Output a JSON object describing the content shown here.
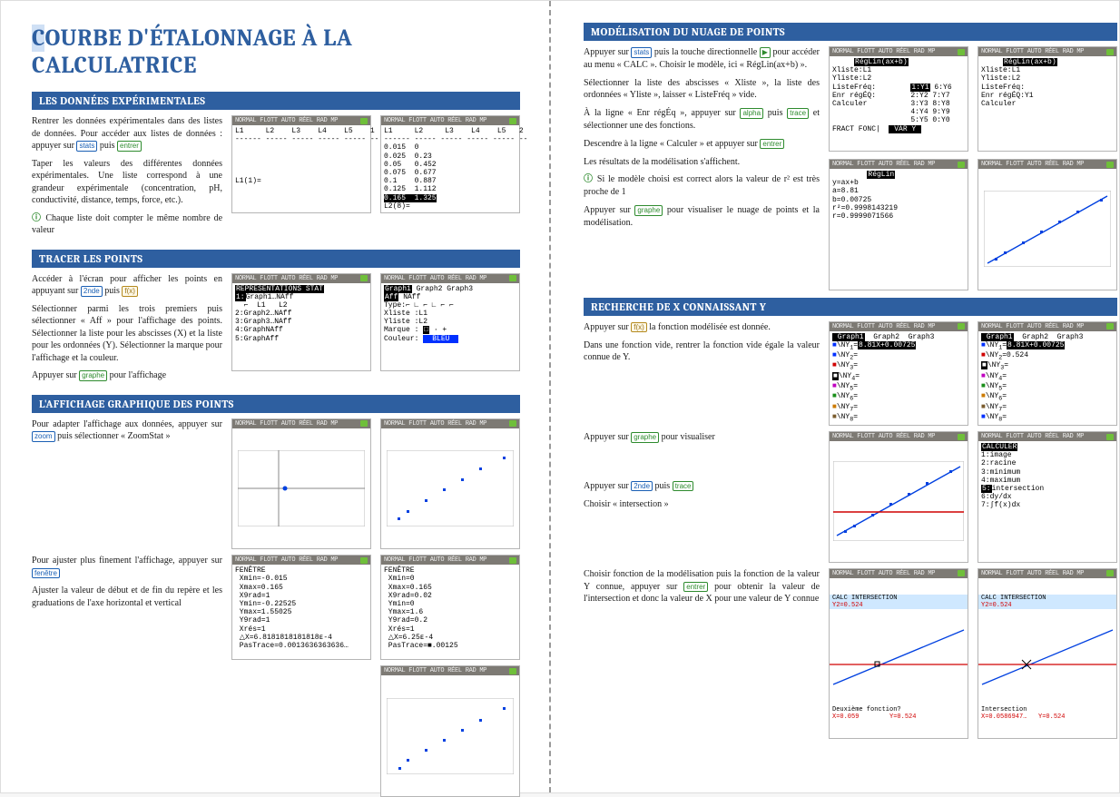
{
  "doc_title": "COURBE D'ÉTALONNAGE À LA CALCULATRICE",
  "calc_header": "NORMAL FLOTT AUTO RÉEL RAD MP",
  "sections": {
    "s1": {
      "heading": "LES DONNÉES EXPÉRIMENTALES",
      "p1a": "Rentrer les données expérimentales dans des listes de données. Pour accéder aux listes de données : appuyer sur ",
      "p1b": " puis ",
      "p2": "Taper les valeurs des différentes données expérimentales. Une liste correspond à une grandeur expérimentale (concentration, pH, conductivité, distance, temps, force, etc.).",
      "p3": " Chaque liste doit compter le même nombre de valeur",
      "key_stats": "stats",
      "key_entrer": "entrer",
      "scr1_cols": "L1     L2    L3    L4    L5    1",
      "scr1_dashes": "------ ----- ----- ----- ----- --",
      "scr1_foot": "L1(1)=",
      "scr2_cols": "L1     L2     L3    L4    L5   2",
      "scr2_rows": [
        "0.015  0",
        "0.025  0.23",
        "0.05   0.452",
        "0.075  0.677",
        "0.1    0.887",
        "0.125  1.112",
        "0.165  1.325"
      ],
      "scr2_foot": "L2(8)="
    },
    "s2": {
      "heading": "TRACER LES POINTS",
      "p1a": "Accéder à l'écran pour afficher les points en appuyant sur ",
      "p1b": " puis ",
      "p2": "Sélectionner parmi les trois premiers puis sélectionner « Aff » pour l'affichage des points. Sélectionner la liste pour les abscisses (X) et la liste pour les ordonnées (Y). Sélectionner la marque pour l'affichage et la couleur.",
      "p3a": "Appuyer sur ",
      "p3b": " pour l'affichage",
      "key_2nde": "2nde",
      "key_fx": "f(x)",
      "key_graphe": "graphe",
      "scr1": "REPRÉSENTATIONS STAT\n1:Graph1…NAff\n  ⌐  L1   L2\n2:Graph2…NAff\n3:Graph3…NAff\n4:GraphNAff\n5:GraphAff",
      "scr2_title": "Graph1 Graph2 Graph3",
      "scr2_body": "Aff NAff\nType:⌐ ∟ ⌐  ∟ ⌐ ⌐\nXliste :L1\nYliste :L2\nMarque : □ · +\nCouleur: ",
      "scr2_color": "BLEU"
    },
    "s3": {
      "heading": "L'AFFICHAGE GRAPHIQUE DES POINTS",
      "p1a": "Pour adapter l'affichage aux données, appuyer sur ",
      "p1b": " puis sélectionner « ZoomStat »",
      "p2a": "Pour ajuster plus finement l'affichage, appuyer sur ",
      "p3": "Ajuster la valeur de début et de fin du repère et les graduations de l'axe horizontal et vertical",
      "key_zoom": "zoom",
      "key_fenetre": "fenêtre",
      "scr_fen1": "FENÊTRE\n Xmin=-0.015\n Xmax=0.165\n X9rad=1\n Ymin=-0.22525\n Ymax=1.55025\n Y9rad=1\n Xrés=1\n △X=6.8181818181818ᴇ-4\n PasTrace=0.0013636363636…",
      "scr_fen2": "FENÊTRE\n Xmin=0\n Xmax=0.165\n X9rad=0.02\n Ymin=0\n Ymax=1.6\n Y9rad=0.2\n Xrés=1\n △X=6.25ᴇ-4\n PasTrace=■.00125"
    },
    "s4": {
      "heading": "MODÉLISATION DU NUAGE DE POINTS",
      "p1a": "Appuyer sur ",
      "p1b": " puis la touche directionnelle ",
      "p1c": " pour accéder au menu « CALC ». Choisir le modèle, ici « RégLin(ax+b) ».",
      "p2": "Sélectionner la liste des abscisses « Xliste », la liste des ordonnées « Yliste », laisser « ListeFréq » vide.",
      "p3a": "À la ligne « Enr régÉq », appuyer sur ",
      "p3b": " puis ",
      "p3c": " et sélectionner une des fonctions.",
      "p4a": "Descendre à la ligne « Calculer » et appuyer sur ",
      "p5": "Les résultats de la modélisation s'affichent.",
      "p6": " Si le modèle choisi est correct alors la valeur de r² est très proche de 1",
      "p7a": "Appuyer sur ",
      "p7b": " pour visualiser le nuage de points et la modélisation.",
      "key_stats": "stats",
      "key_right": "▶",
      "key_alpha": "alpha",
      "key_trace": "trace",
      "key_entrer": "entrer",
      "key_graphe": "graphe",
      "scr1_title": "RégLin(ax+b)",
      "scr1_body": "Xliste:L1\nYliste:L2\nListeFréq:\nEnr régÉQ:\nCalculer",
      "scr1_menu": "1:Y1 6:Y6\n2:Y2 7:Y7\n3:Y3 8:Y8\n4:Y4 9:Y9\n5:Y5 0:Y0",
      "scr1_tabs": "FRACT FONC|    |    VAR Y",
      "scr2_body": "Xliste:L1\nYliste:L2\nListeFréq:\nEnr régÉQ:Y1\nCalculer",
      "scr3_title": "RégLin",
      "scr3_body": "y=ax+b\na=8.81\nb=0.00725\nr²=0.9998143219\nr=0.9999071566"
    },
    "s5": {
      "heading": "RECHERCHE DE X CONNAISSANT Y",
      "p1a": "Appuyer sur ",
      "p1b": " la fonction modélisée est donnée.",
      "p2": "Dans une fonction vide, rentrer la fonction vide égale la valeur connue de Y.",
      "p3a": "Appuyer sur ",
      "p3b": " pour visualiser",
      "p4a": "Appuyer sur ",
      "p4b": " puis ",
      "p5": "Choisir « intersection »",
      "p6a": "Choisir fonction de la modélisation puis la fonction de la valeur Y connue, appuyer sur ",
      "p6b": " pour obtenir la valeur de l'intersection et donc la valeur de X pour une valeur de Y connue",
      "key_fx": "f(x)",
      "key_graphe": "graphe",
      "key_2nde": "2nde",
      "key_trace": "trace",
      "key_entrer": "entrer",
      "scr_y_title": " Graph1  Graph2  Graph3",
      "scr_y_body1": "\\NY1=8.81X+0.00725\n\\NY2=\n\\NY3=\n\\NY4=\n\\NY5=\n\\NY6=\n\\NY7=\n\\NY8=",
      "scr_y_body2": "\\NY1=8.81X+0.00725\n\\NY2=0.524\n\\NY3=\n\\NY4=\n\\NY5=\n\\NY6=\n\\NY7=\n\\NY8=",
      "scr_calc_menu": "CALCULER\n1:image\n2:racine\n3:minimum\n4:maximum\n5:intersection\n6:dy/dx\n7:∫f(x)dx",
      "scr_int1_hdr": "CALC INTERSECTION",
      "scr_int_y": "Y2=0.524",
      "scr_int1_foot1": "Deuxième fonction?",
      "scr_int1_foot2": "X=0.059        Y=0.524",
      "scr_int2_foot1": "Intersection",
      "scr_int2_foot2": "X=0.0586947…   Y=0.524"
    }
  },
  "chart_data": [
    {
      "id": "axes-plot",
      "type": "scatter",
      "x": [
        0.015,
        0.075
      ],
      "y": [
        0,
        0
      ],
      "note": "default window with centered axes and blue point near origin"
    },
    {
      "id": "points-zoomstat",
      "type": "scatter",
      "x": [
        0.015,
        0.025,
        0.05,
        0.075,
        0.1,
        0.125,
        0.165
      ],
      "y": [
        0,
        0.23,
        0.452,
        0.677,
        0.887,
        1.112,
        1.325
      ]
    },
    {
      "id": "points-adjusted",
      "type": "scatter",
      "x": [
        0.015,
        0.025,
        0.05,
        0.075,
        0.1,
        0.125,
        0.165
      ],
      "y": [
        0,
        0.23,
        0.452,
        0.677,
        0.887,
        1.112,
        1.325
      ],
      "xlim": [
        0,
        0.165
      ],
      "ylim": [
        0,
        1.6
      ],
      "xgrad": 0.02,
      "ygrad": 0.2
    },
    {
      "id": "reg-line",
      "type": "line",
      "series": [
        {
          "name": "data",
          "type": "scatter",
          "x": [
            0.015,
            0.025,
            0.05,
            0.075,
            0.1,
            0.125,
            0.165
          ],
          "y": [
            0,
            0.23,
            0.452,
            0.677,
            0.887,
            1.112,
            1.325
          ]
        },
        {
          "name": "fit",
          "type": "line",
          "equation": "y=8.81x+0.00725",
          "x": [
            0,
            0.165
          ],
          "y": [
            0.00725,
            1.461
          ]
        }
      ],
      "xlim": [
        0,
        0.165
      ],
      "ylim": [
        0,
        1.6
      ]
    },
    {
      "id": "intersection",
      "type": "line",
      "series": [
        {
          "name": "Y1",
          "equation": "y=8.81x+0.00725",
          "color": "#0030ff"
        },
        {
          "name": "Y2",
          "equation": "y=0.524",
          "color": "#d00000"
        }
      ],
      "intersection": {
        "x": 0.0586947,
        "y": 0.524
      }
    }
  ]
}
